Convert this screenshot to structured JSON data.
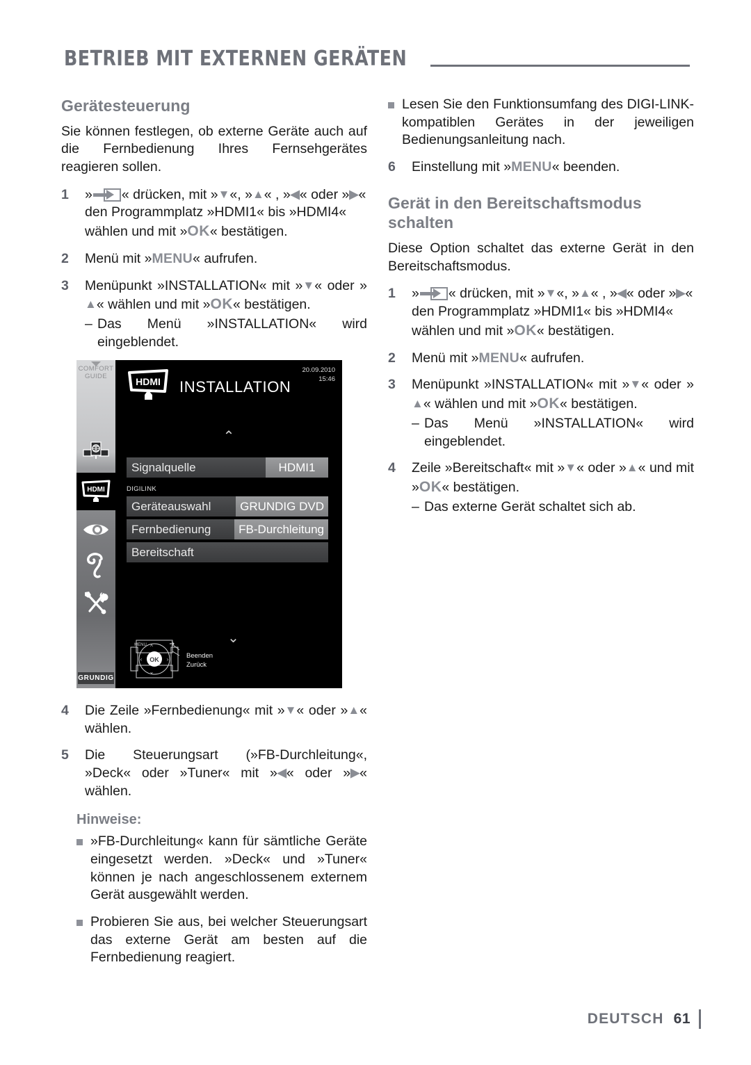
{
  "header": {
    "chapter_title": "BETRIEB MIT EXTERNEN GERÄTEN"
  },
  "left_column": {
    "heading": "Gerätesteuerung",
    "intro": "Sie können festlegen, ob externe Geräte auch auf die Fernbedienung Ihres Fernsehgerätes reagieren sollen.",
    "steps": [
      {
        "num": "1",
        "text_before_icon": "»",
        "icon": "source-icon",
        "text_after_icon": "« drücken, mit »",
        "key_down": "v",
        "mid1": "«, »",
        "key_up": "^",
        "mid2": "« , »",
        "key_left": "<",
        "mid3": "« oder »",
        "key_right": ">",
        "mid4": "«",
        "line2": "den Programmplatz »HDMI1« bis »HDMI4«",
        "line3_a": "wählen und mit »",
        "line3_key": "OK",
        "line3_b": "« bestätigen."
      },
      {
        "num": "2",
        "a": "Menü mit »",
        "key": "MENU",
        "b": "« aufrufen."
      },
      {
        "num": "3",
        "a": "Menüpunkt »INSTALLATION« mit »",
        "key1": "v",
        "b": "« oder »",
        "key2": "^",
        "c": "« wählen und mit »",
        "key3": "OK",
        "d": "« bestätigen.",
        "sub": "Das Menü »INSTALLATION« wird eingeblendet."
      },
      {
        "num": "4",
        "a": "Die Zeile »Fernbedienung« mit »",
        "key1": "v",
        "b": "« oder »",
        "key2": "^",
        "c": "« wählen."
      },
      {
        "num": "5",
        "a": "Die Steuerungsart (»FB-Durchleitung«, »Deck« oder »Tuner« mit »",
        "key1": "<",
        "b": "« oder »",
        "key2": ">",
        "c": "« wählen."
      }
    ],
    "notes_heading": "Hinweise:",
    "notes": [
      "»FB-Durchleitung« kann für sämtliche Geräte eingesetzt werden. »Deck« und »Tuner« können je nach angeschlossenem externem Gerät ausgewählt werden.",
      "Probieren Sie aus, bei welcher Steuerungsart das externe Gerät am besten auf die Fernbedienung reagiert."
    ]
  },
  "right_column": {
    "note_top": "Lesen Sie den Funktionsumfang des DIGI-LINK-kompatiblen Gerätes in der jeweiligen Bedienungsanleitung nach.",
    "step6": {
      "num": "6",
      "a": "Einstellung mit »",
      "key": "MENU",
      "b": "« beenden."
    },
    "heading": "Gerät in den Bereitschaftsmodus schalten",
    "intro": "Diese Option schaltet das externe Gerät in den Bereitschaftsmodus.",
    "steps": [
      {
        "num": "1",
        "text_before_icon": "»",
        "icon": "source-icon",
        "text_after_icon": "« drücken, mit »",
        "key_down": "v",
        "mid1": "«, »",
        "key_up": "^",
        "mid2": "« , »",
        "key_left": "<",
        "mid3": "« oder »",
        "key_right": ">",
        "mid4": "«",
        "line2": "den Programmplatz »HDMI1« bis »HDMI4«",
        "line3_a": "wählen und mit »",
        "line3_key": "OK",
        "line3_b": "« bestätigen."
      },
      {
        "num": "2",
        "a": "Menü mit »",
        "key": "MENU",
        "b": "« aufrufen."
      },
      {
        "num": "3",
        "a": "Menüpunkt »INSTALLATION« mit »",
        "key1": "v",
        "b": "« oder »",
        "key2": "^",
        "c": "« wählen und mit »",
        "key3": "OK",
        "d": "« bestätigen.",
        "sub": "Das Menü »INSTALLATION« wird eingeblendet."
      },
      {
        "num": "4",
        "a": "Zeile »Bereitschaft« mit »",
        "key1": "v",
        "b": "« oder »",
        "key2": "^",
        "c": "« und mit »",
        "key3": "OK",
        "d": "« bestätigen.",
        "sub": "Das externe Gerät schaltet sich ab."
      }
    ]
  },
  "tv_menu": {
    "sidebar": {
      "label_line1": "COMFORT",
      "label_line2": "GUIDE",
      "icons": [
        "source-network-icon",
        "hdmi-icon",
        "eye-icon",
        "ear-icon",
        "tools-icon"
      ],
      "brand": "GRUNDIG"
    },
    "title": "INSTALLATION",
    "title_badge": "HDMI",
    "date": "20.09.2010",
    "time": "15:46",
    "group_label": "DIGILINK",
    "rows": [
      {
        "label": "Signalquelle",
        "value": "HDMI1"
      },
      {
        "label": "Geräteauswahl",
        "value": "GRUNDIG DVD"
      },
      {
        "label": "Fernbedienung",
        "value": "FB-Durchleitung"
      },
      {
        "label": "Bereitschaft",
        "value": ""
      }
    ],
    "nav_hint": {
      "ok": "OK",
      "line1": "Beenden",
      "line2": "Zurück"
    }
  },
  "footer": {
    "language": "DEUTSCH",
    "page_number": "61"
  },
  "colors": {
    "heading_gray": "#7a7d84",
    "key_gray": "#8a8d94",
    "rule_gray": "#6e7179",
    "page_number": "#3b3e46",
    "body_black": "#1a1a1a"
  }
}
